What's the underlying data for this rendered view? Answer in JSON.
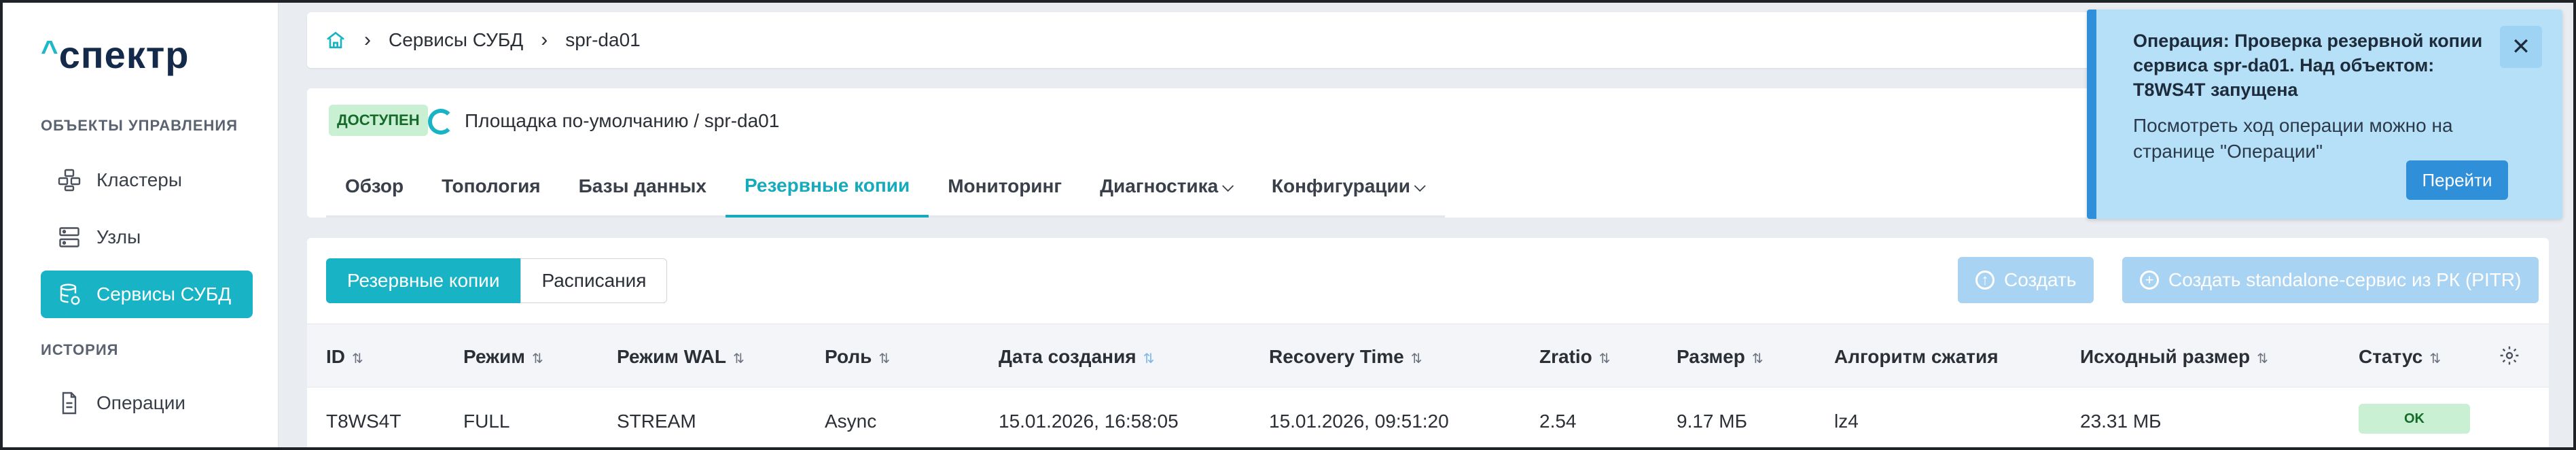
{
  "app": {
    "logo": "спектр",
    "logo_mark": "^"
  },
  "sidebar": {
    "section_objects": "ОБЪЕКТЫ УПРАВЛЕНИЯ",
    "section_history": "ИСТОРИЯ",
    "items": [
      {
        "label": "Кластеры",
        "icon": "clusters-icon"
      },
      {
        "label": "Узлы",
        "icon": "server-icon"
      },
      {
        "label": "Сервисы СУБД",
        "icon": "database-icon",
        "active": true
      },
      {
        "label": "Операции",
        "icon": "document-icon"
      }
    ]
  },
  "breadcrumb": {
    "home_icon": "home-icon",
    "items": [
      "Сервисы СУБД",
      "spr-da01"
    ]
  },
  "object": {
    "status_badge": "ДОСТУПЕН",
    "path_prefix": "Площадка по-умолчанию /",
    "name": "spr-da01"
  },
  "tabs": [
    {
      "label": "Обзор"
    },
    {
      "label": "Топология"
    },
    {
      "label": "Базы данных"
    },
    {
      "label": "Резервные копии",
      "active": true
    },
    {
      "label": "Мониторинг"
    },
    {
      "label": "Диагностика",
      "dropdown": true
    },
    {
      "label": "Конфигурации",
      "dropdown": true
    }
  ],
  "subtabs": {
    "backups": "Резервные копии",
    "schedules": "Расписания"
  },
  "actions": {
    "create": "Создать",
    "create_standalone": "Создать standalone-сервис из РК (PITR)"
  },
  "table": {
    "columns": [
      "ID",
      "Режим",
      "Режим WAL",
      "Роль",
      "Дата создания",
      "Recovery Time",
      "Zratio",
      "Размер",
      "Алгоритм сжатия",
      "Исходный размер",
      "Статус"
    ],
    "rows": [
      {
        "id": "T8WS4T",
        "mode": "FULL",
        "wal_mode": "STREAM",
        "role": "Async",
        "created": "15.01.2026, 16:58:05",
        "recovery_time": "15.01.2026, 09:51:20",
        "zratio": "2.54",
        "size": "9.17 МБ",
        "compression": "lz4",
        "source_size": "23.31 МБ",
        "status": "OK"
      }
    ]
  },
  "toast": {
    "title": "Операция: Проверка резервной копии сервиса spr-da01. Над объектом: T8WS4T запущена",
    "message": "Посмотреть ход операции можно на странице \"Операции\"",
    "button": "Перейти"
  },
  "colors": {
    "accent": "#19b3c6",
    "info": "#2f8fd8",
    "ok_bg": "#c9f0d3"
  }
}
